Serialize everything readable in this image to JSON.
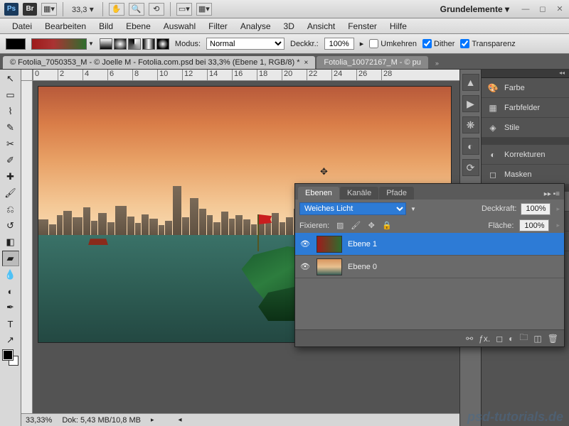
{
  "top": {
    "ps": "Ps",
    "br": "Br",
    "zoom": "33,3",
    "workspace": "Grundelemente ▾"
  },
  "menu": [
    "Datei",
    "Bearbeiten",
    "Bild",
    "Ebene",
    "Auswahl",
    "Filter",
    "Analyse",
    "3D",
    "Ansicht",
    "Fenster",
    "Hilfe"
  ],
  "options": {
    "mode_label": "Modus:",
    "mode_value": "Normal",
    "opacity_label": "Deckkr.:",
    "opacity_value": "100%",
    "reverse": "Umkehren",
    "dither": "Dither",
    "transparency": "Transparenz"
  },
  "tabs": [
    {
      "label": "© Fotolia_7050353_M - © Joelle M - Fotolia.com.psd bei 33,3% (Ebene 1, RGB/8) *",
      "active": true
    },
    {
      "label": "Fotolia_10072167_M - © pu",
      "active": false
    }
  ],
  "ruler_ticks": [
    "0",
    "2",
    "4",
    "6",
    "8",
    "10",
    "12",
    "14",
    "16",
    "18",
    "20",
    "22",
    "24",
    "26",
    "28"
  ],
  "status": {
    "zoom": "33,33%",
    "dok": "Dok: 5,43 MB/10,8 MB"
  },
  "dock_panels": {
    "farbe": "Farbe",
    "farbfelder": "Farbfelder",
    "stile": "Stile",
    "korrekturen": "Korrekturen",
    "masken": "Masken",
    "ebenen": "Ebenen",
    "kanale": "Kanäle",
    "pfade": "Pfade"
  },
  "layers_panel": {
    "tabs": {
      "ebenen": "Ebenen",
      "kanale": "Kanäle",
      "pfade": "Pfade"
    },
    "blend_mode": "Weiches Licht",
    "deckkraft_label": "Deckkraft:",
    "deckkraft_value": "100%",
    "fix_label": "Fixieren:",
    "flache_label": "Fläche:",
    "flache_value": "100%",
    "layers": [
      {
        "name": "Ebene 1",
        "selected": true
      },
      {
        "name": "Ebene 0",
        "selected": false
      }
    ]
  },
  "watermark": "psd-tutorials.de"
}
